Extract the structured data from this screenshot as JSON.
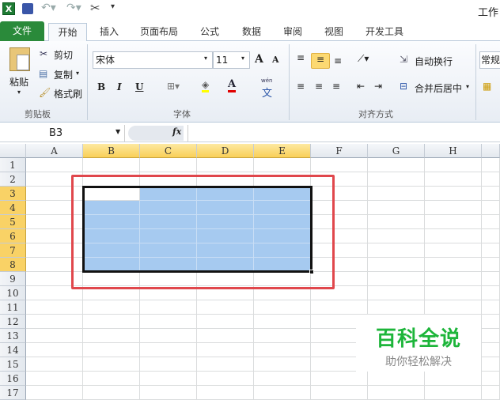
{
  "title_bar": {
    "title": "工作",
    "app_icon": "excel-icon",
    "quick_access": [
      "save-icon",
      "undo-icon",
      "redo-icon",
      "tools-icon",
      "customize-icon"
    ]
  },
  "tabs": [
    {
      "label": "文件"
    },
    {
      "label": "开始",
      "active": true
    },
    {
      "label": "插入"
    },
    {
      "label": "页面布局"
    },
    {
      "label": "公式"
    },
    {
      "label": "数据"
    },
    {
      "label": "审阅"
    },
    {
      "label": "视图"
    },
    {
      "label": "开发工具"
    }
  ],
  "ribbon": {
    "clipboard": {
      "label": "剪贴板",
      "paste": "粘贴",
      "cut": "剪切",
      "copy": "复制",
      "format_painter": "格式刷"
    },
    "font": {
      "label": "字体",
      "font_name": "宋体",
      "font_size": "11",
      "bold": "B",
      "italic": "I",
      "underline": "U",
      "grow": "A",
      "shrink": "A",
      "font_color": "A",
      "phonetic_top": "wén",
      "phonetic": "文",
      "fill_color": "#ffff00",
      "text_color": "#e00000"
    },
    "alignment": {
      "label": "对齐方式",
      "wrap_text": "自动换行",
      "merge_center": "合并后居中"
    },
    "number": {
      "format": "常规"
    }
  },
  "formula_bar": {
    "name_box": "B3",
    "fx": "fx",
    "formula": ""
  },
  "sheet": {
    "columns": [
      "A",
      "B",
      "C",
      "D",
      "E",
      "F",
      "G",
      "H"
    ],
    "rows": [
      "1",
      "2",
      "3",
      "4",
      "5",
      "6",
      "7",
      "8",
      "9",
      "10",
      "11",
      "12",
      "13",
      "14",
      "15",
      "16",
      "17"
    ],
    "active_cell": "B3",
    "selection": "B3:E8",
    "selected_columns": [
      "B",
      "C",
      "D",
      "E"
    ],
    "selected_rows": [
      "3",
      "4",
      "5",
      "6",
      "7",
      "8"
    ],
    "highlight_color": "#a6caf0",
    "annotation_color": "#e0474c"
  },
  "watermark": {
    "title": "百科全说",
    "subtitle": "助你轻松解决",
    "color": "#1db53a"
  }
}
